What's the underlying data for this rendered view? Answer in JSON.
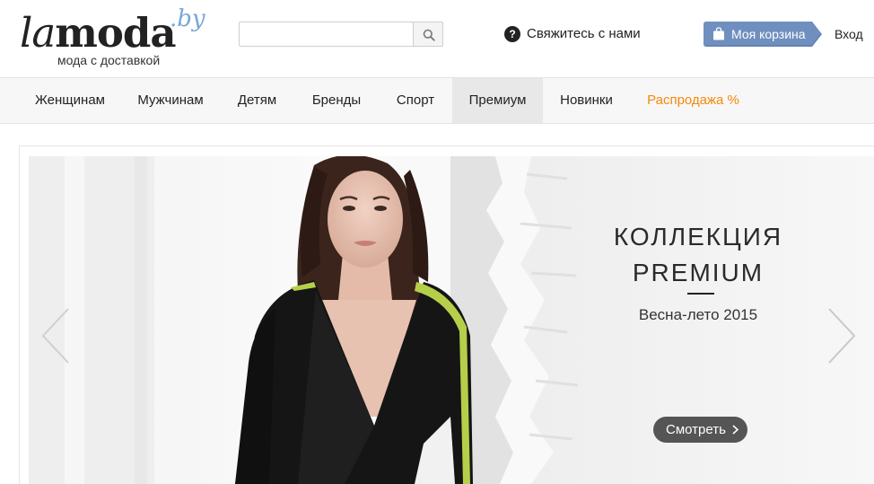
{
  "header": {
    "logo": {
      "word_la": "la",
      "word_moda": "moda",
      "domain": ".by",
      "tagline": "мода с доставкой"
    },
    "search": {
      "value": "",
      "placeholder": "",
      "icon": "search-icon"
    },
    "contact": {
      "icon": "question-icon",
      "icon_glyph": "?",
      "label": "Свяжитесь с нами"
    },
    "cart": {
      "icon": "shopping-bag-icon",
      "label": "Моя корзина",
      "color": "#6f8fbf"
    },
    "login": {
      "label": "Вход"
    }
  },
  "nav": {
    "items": [
      {
        "label": "Женщинам"
      },
      {
        "label": "Мужчинам"
      },
      {
        "label": "Детям"
      },
      {
        "label": "Бренды"
      },
      {
        "label": "Спорт"
      },
      {
        "label": "Премиум",
        "active": true
      },
      {
        "label": "Новинки"
      },
      {
        "label": "Распродажа %",
        "color": "#f5890a"
      }
    ]
  },
  "banner": {
    "title": "КОЛЛЕКЦИЯ\nPREMIUM",
    "subtitle": "Весна-лето 2015",
    "button": {
      "label": "Смотреть",
      "icon": "chevron-right-icon"
    },
    "prev_icon": "chevron-left-icon",
    "next_icon": "chevron-right-icon"
  }
}
